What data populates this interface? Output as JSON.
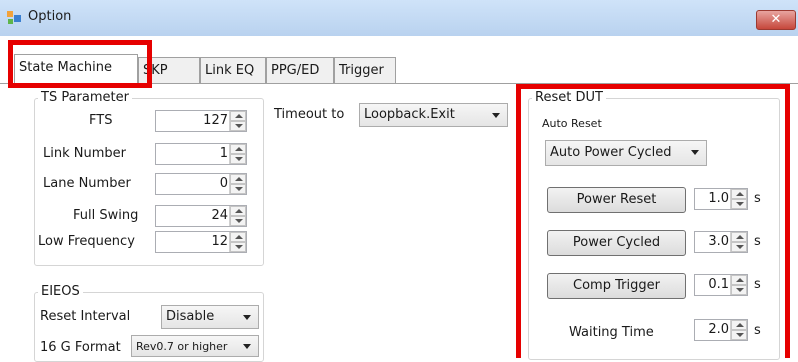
{
  "window": {
    "title": "Option",
    "close_glyph": "✕"
  },
  "tabs": [
    {
      "label": "State Machine",
      "active": true
    },
    {
      "label": "SKP",
      "active": false
    },
    {
      "label": "Link EQ",
      "active": false
    },
    {
      "label": "PPG/ED",
      "active": false
    },
    {
      "label": "Trigger",
      "active": false
    }
  ],
  "ts_parameter": {
    "title": "TS Parameter",
    "fields": [
      {
        "label": "FTS",
        "value": "127"
      },
      {
        "label": "Link Number",
        "value": "1"
      },
      {
        "label": "Lane Number",
        "value": "0"
      },
      {
        "label": "Full Swing",
        "value": "24"
      },
      {
        "label": "Low Frequency",
        "value": "12"
      }
    ]
  },
  "timeout": {
    "label": "Timeout to",
    "value": "Loopback.Exit"
  },
  "eieos": {
    "title": "EIEOS",
    "reset_interval_label": "Reset Interval",
    "reset_interval_value": "Disable",
    "format_label": "16 G Format",
    "format_value": "Rev0.7 or higher"
  },
  "reset_dut": {
    "title": "Reset DUT",
    "auto_reset_label": "Auto Reset",
    "auto_reset_value": "Auto Power Cycled",
    "rows": [
      {
        "button": "Power Reset",
        "value": "1.0",
        "unit": "s"
      },
      {
        "button": "Power Cycled",
        "value": "3.0",
        "unit": "s"
      },
      {
        "button": "Comp Trigger",
        "value": "0.1",
        "unit": "s"
      }
    ],
    "waiting_time_label": "Waiting Time",
    "waiting_time_value": "2.0",
    "waiting_time_unit": "s"
  },
  "colors": {
    "highlight": "#e60000",
    "titlebar": "#cfe3f9",
    "close": "#c6473b"
  },
  "icons": [
    "window-app-icon",
    "close-icon",
    "spin-up-icon",
    "spin-down-icon",
    "dropdown-arrow-icon"
  ]
}
